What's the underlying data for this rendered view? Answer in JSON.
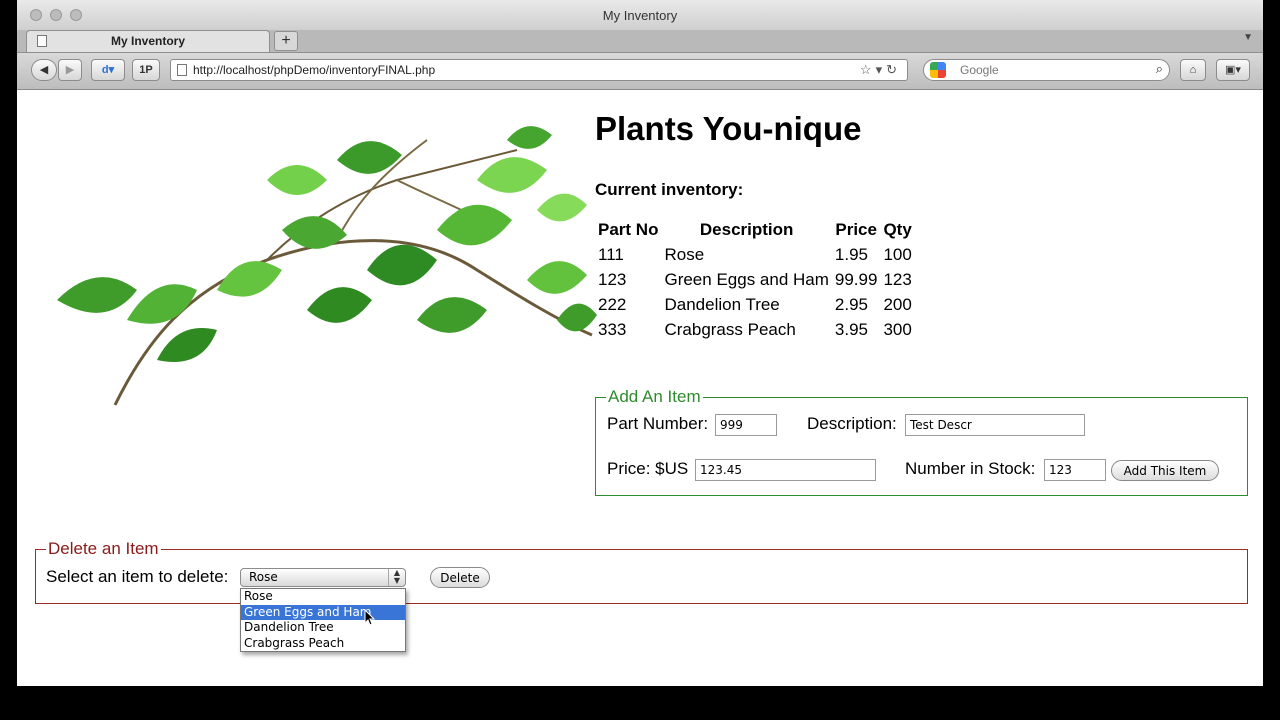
{
  "window": {
    "title": "My Inventory",
    "tab_label": "My Inventory",
    "newtab_label": "+",
    "url": "http://localhost/phpDemo/inventoryFINAL.php",
    "search_placeholder": "Google",
    "onep_label": "1P"
  },
  "page": {
    "title": "Plants You-nique",
    "subhead": "Current inventory:",
    "table": {
      "headers": [
        "Part No",
        "Description",
        "Price",
        "Qty"
      ],
      "rows": [
        [
          "111",
          "Rose",
          "1.95",
          "100"
        ],
        [
          "123",
          "Green Eggs and Ham",
          "99.99",
          "123"
        ],
        [
          "222",
          "Dandelion Tree",
          "2.95",
          "200"
        ],
        [
          "333",
          "Crabgrass Peach",
          "3.95",
          "300"
        ]
      ]
    },
    "add_form": {
      "legend": "Add An Item",
      "part_label": "Part Number:",
      "part_value": "999",
      "desc_label": "Description:",
      "desc_value": "Test Descr",
      "price_label": "Price: $US",
      "price_value": "123.45",
      "stock_label": "Number in Stock:",
      "stock_value": "123",
      "submit_label": "Add This Item"
    },
    "delete_form": {
      "legend": "Delete an Item",
      "select_label": "Select an item to delete:",
      "selected_value": "Rose",
      "options": [
        "Rose",
        "Green Eggs and Ham",
        "Dandelion Tree",
        "Crabgrass Peach"
      ],
      "highlighted_option": "Green Eggs and Ham",
      "delete_label": "Delete"
    }
  },
  "colors": {
    "add_border": "#2e8b2e",
    "delete_border": "#9b2a2a",
    "highlight": "#3875d7"
  }
}
